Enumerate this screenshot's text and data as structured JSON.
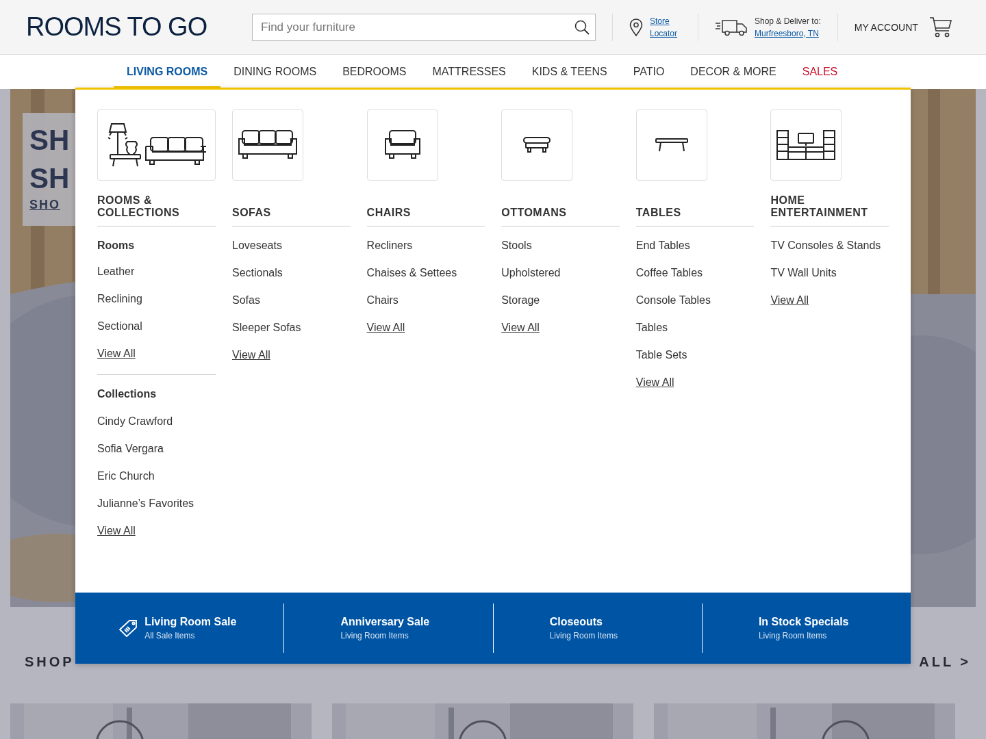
{
  "header": {
    "logo": "ROOMS TO GO",
    "search": {
      "placeholder": "Find your furniture"
    },
    "store_locator": "Store Locator",
    "deliver": {
      "label": "Shop & Deliver to:",
      "location": "Murfreesboro, TN"
    },
    "account": "MY ACCOUNT"
  },
  "nav": {
    "items": [
      {
        "label": "LIVING ROOMS",
        "selected": true,
        "kind": "category"
      },
      {
        "label": "DINING ROOMS",
        "selected": false,
        "kind": "category"
      },
      {
        "label": "BEDROOMS",
        "selected": false,
        "kind": "category"
      },
      {
        "label": "MATTRESSES",
        "selected": false,
        "kind": "category"
      },
      {
        "label": "KIDS & TEENS",
        "selected": false,
        "kind": "category"
      },
      {
        "label": "PATIO",
        "selected": false,
        "kind": "category"
      },
      {
        "label": "DECOR & MORE",
        "selected": false,
        "kind": "category"
      },
      {
        "label": "SALES",
        "selected": false,
        "kind": "sale"
      }
    ]
  },
  "background": {
    "hero_texts": [
      "SH",
      "SH",
      "SHO"
    ],
    "shop_label": "SHOP",
    "view_all": "ALL >"
  },
  "menu": {
    "columns": [
      {
        "heading": "ROOMS & COLLECTIONS",
        "kind": "room",
        "sections": [
          {
            "title": "Rooms",
            "links": [
              {
                "label": "Leather",
                "kind": "link"
              },
              {
                "label": "Reclining",
                "kind": "link"
              },
              {
                "label": "Sectional",
                "kind": "link"
              },
              {
                "label": "View All",
                "kind": "view_all"
              }
            ]
          },
          {
            "title": "Collections",
            "links": [
              {
                "label": "Cindy Crawford",
                "kind": "link"
              },
              {
                "label": "Sofia Vergara",
                "kind": "link"
              },
              {
                "label": "Eric Church",
                "kind": "link"
              },
              {
                "label": "Julianne’s Favorites",
                "kind": "link"
              },
              {
                "label": "View All",
                "kind": "view_all"
              }
            ]
          }
        ]
      },
      {
        "heading": "SOFAS",
        "kind": "sofa",
        "sections": [
          {
            "links": [
              {
                "label": "Loveseats",
                "kind": "link"
              },
              {
                "label": "Sectionals",
                "kind": "link"
              },
              {
                "label": "Sofas",
                "kind": "link"
              },
              {
                "label": "Sleeper Sofas",
                "kind": "link"
              },
              {
                "label": "View All",
                "kind": "view_all"
              }
            ]
          }
        ]
      },
      {
        "heading": "CHAIRS",
        "kind": "chair",
        "sections": [
          {
            "links": [
              {
                "label": "Recliners",
                "kind": "link"
              },
              {
                "label": "Chaises & Settees",
                "kind": "link"
              },
              {
                "label": "Chairs",
                "kind": "link"
              },
              {
                "label": "View All",
                "kind": "view_all"
              }
            ]
          }
        ]
      },
      {
        "heading": "OTTOMANS",
        "kind": "ottoman",
        "sections": [
          {
            "links": [
              {
                "label": "Stools",
                "kind": "link"
              },
              {
                "label": "Upholstered",
                "kind": "link"
              },
              {
                "label": "Storage",
                "kind": "link"
              },
              {
                "label": "View All",
                "kind": "view_all"
              }
            ]
          }
        ]
      },
      {
        "heading": "TABLES",
        "kind": "table",
        "sections": [
          {
            "links": [
              {
                "label": "End Tables",
                "kind": "link"
              },
              {
                "label": "Coffee Tables",
                "kind": "link"
              },
              {
                "label": "Console Tables",
                "kind": "link"
              },
              {
                "label": "Tables",
                "kind": "link"
              },
              {
                "label": "Table Sets",
                "kind": "link"
              },
              {
                "label": "View All",
                "kind": "view_all"
              }
            ]
          }
        ]
      },
      {
        "heading": "HOME ENTERTAINMENT",
        "kind": "entertainment",
        "sections": [
          {
            "links": [
              {
                "label": "TV Consoles & Stands",
                "kind": "link"
              },
              {
                "label": "TV Wall Units",
                "kind": "link"
              },
              {
                "label": "View All",
                "kind": "view_all"
              }
            ]
          }
        ]
      }
    ],
    "promos": [
      {
        "title": "Living Room Sale",
        "subtitle": "All Sale Items",
        "kind": "tag"
      },
      {
        "title": "Anniversary Sale",
        "subtitle": "Living Room Items",
        "kind": "plain"
      },
      {
        "title": "Closeouts",
        "subtitle": "Living Room Items",
        "kind": "plain"
      },
      {
        "title": "In Stock Specials",
        "subtitle": "Living Room Items",
        "kind": "plain"
      }
    ]
  }
}
